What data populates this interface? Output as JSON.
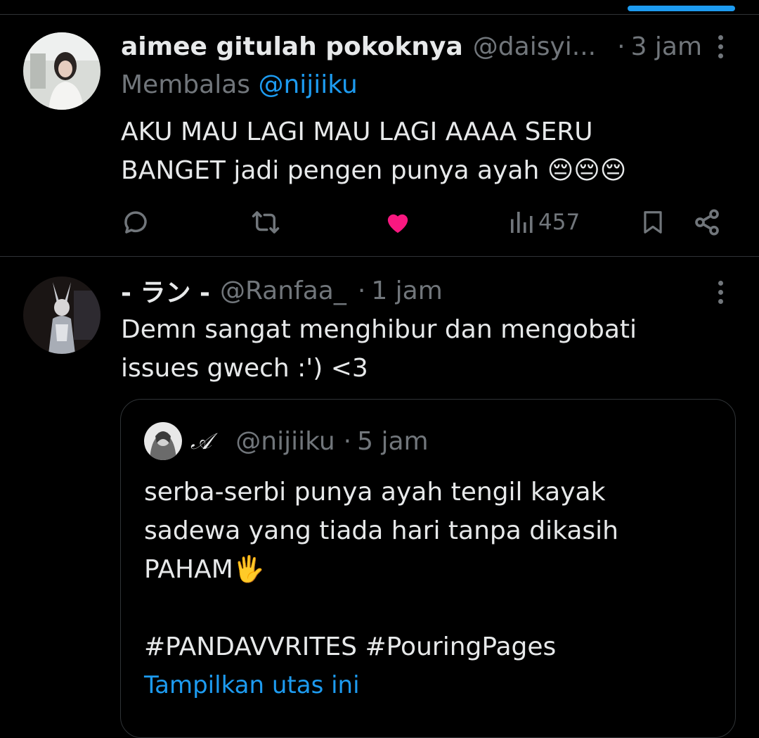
{
  "colors": {
    "accent": "#1d9bf0",
    "like": "#f91880",
    "muted": "#71767b",
    "text": "#e7e9ea",
    "border": "#2f3336"
  },
  "tweets": [
    {
      "name": "aimee gitulah pokoknya",
      "handle": "@daisyi...",
      "dot": "·",
      "time": "3 jam",
      "replying_prefix": "Membalas",
      "replying_to": "@nijiiku",
      "text": "AKU MAU LAGI MAU LAGI AAAA SERU BANGET jadi pengen punya ayah 😔😔😔",
      "views": "457",
      "liked": true,
      "icons": [
        "reply-icon",
        "retweet-icon",
        "like-icon",
        "views-icon",
        "bookmark-icon",
        "share-icon",
        "more-icon"
      ]
    },
    {
      "name": "- ラン -",
      "handle": "@Ranfaa_",
      "dot": "·",
      "time": "1 jam",
      "text": "Demn sangat menghibur dan mengobati issues gwech :') <3",
      "quote": {
        "name": "𝒜",
        "handle": "@nijiiku",
        "dot": "·",
        "time": "5 jam",
        "text_lines": [
          "serba-serbi punya ayah tengil kayak",
          "sadewa yang tiada hari tanpa dikasih",
          "PAHAM🖐️"
        ],
        "hashtags": "#PANDAVVRITES #PouringPages",
        "show_thread": "Tampilkan utas ini"
      }
    }
  ]
}
